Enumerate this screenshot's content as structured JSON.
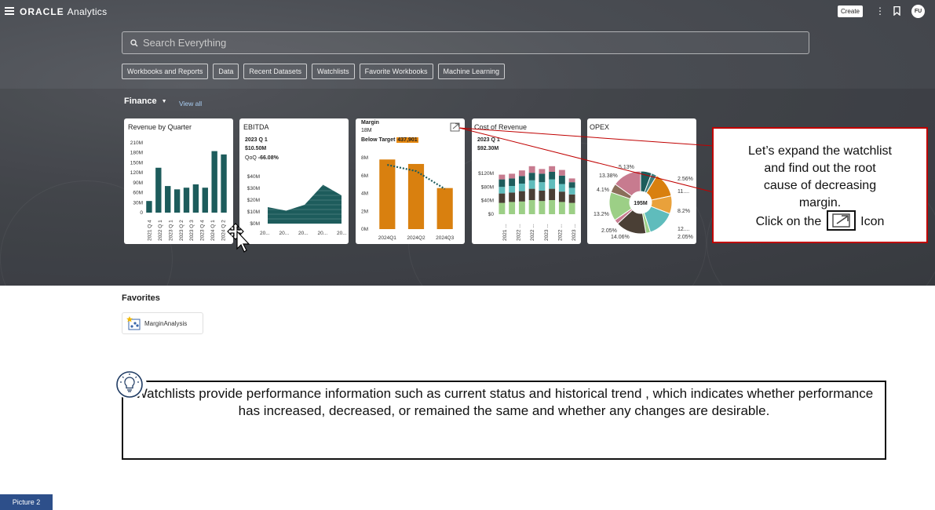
{
  "app": {
    "brand_main": "ORACLE",
    "brand_sub": "Analytics",
    "create_label": "Create",
    "avatar_initials": "FU"
  },
  "search": {
    "placeholder": "Search Everything"
  },
  "chips": [
    "Workbooks and Reports",
    "Data",
    "Recent Datasets",
    "Watchlists",
    "Favorite Workbooks",
    "Machine Learning"
  ],
  "finance": {
    "label": "Finance",
    "view_all": "View all"
  },
  "cards": {
    "revenue": {
      "title": "Revenue by Quarter",
      "chart_data": {
        "type": "bar",
        "categories": [
          "2021 Q 4",
          "2022 Q 1",
          "2023 Q 1",
          "2023 Q 2",
          "2023 Q 3",
          "2023 Q 4",
          "2024 Q 1",
          "2024 Q 2"
        ],
        "values": [
          35,
          135,
          80,
          70,
          75,
          85,
          75,
          185,
          175
        ],
        "ytick_labels": [
          "210M",
          "180M",
          "150M",
          "120M",
          "90M",
          "60M",
          "30M",
          "0"
        ],
        "ylim": [
          0,
          210
        ],
        "color": "#1d5c5c"
      }
    },
    "ebitda": {
      "title": "EBITDA",
      "kpi_period": "2023 Q 1",
      "kpi_value": "$10.50M",
      "kpi_qoq_label": "QoQ",
      "kpi_qoq_value": "-66.08%",
      "chart_data": {
        "type": "area",
        "values": [
          14,
          11,
          16,
          33,
          24
        ],
        "ytick_labels": [
          "$40M",
          "$30M",
          "$20M",
          "$10M",
          "$0M"
        ],
        "xtick_labels": [
          "20...",
          "20...",
          "20...",
          "20...",
          "20..."
        ],
        "ylim": [
          0,
          40
        ],
        "color": "#1d5c5c"
      }
    },
    "margin": {
      "title": "Margin",
      "subtitle": "18M",
      "below_label": "Below Target",
      "below_value": "437,901",
      "chart_data": {
        "type": "bar",
        "categories": [
          "2024Q1",
          "2024Q2",
          "2024Q3"
        ],
        "values": [
          7.8,
          7.3,
          4.6
        ],
        "trend": [
          7.2,
          6.5,
          4.5
        ],
        "ytick_labels": [
          "8M",
          "6M",
          "4M",
          "2M",
          "0M"
        ],
        "ylim": [
          0,
          8
        ],
        "bar_color": "#d9800f",
        "trend_color": "#1d5c5c"
      }
    },
    "cost": {
      "title": "Cost of Revenue",
      "kpi_period": "2023 Q 1",
      "kpi_value": "$92.30M",
      "chart_data": {
        "type": "bar",
        "stacked": true,
        "ytick_labels": [
          "$120M",
          "$80M",
          "$40M",
          "$0"
        ],
        "xtick_labels": [
          "2021 ...",
          "2022 ...",
          "2022 ...",
          "2023 ...",
          "2022 ...",
          "2023 ..."
        ],
        "colors": [
          "#9ccf86",
          "#4a3f35",
          "#5fbcbc",
          "#1d5c5c",
          "#c77b8f",
          "#d9800f"
        ]
      }
    },
    "opex": {
      "title": "OPEX",
      "center_label": "195M",
      "chart_data": {
        "type": "pie",
        "labels": [
          "5.13%",
          "2.56%",
          "11....",
          "8.2%",
          "12....",
          "2.05%",
          "14.06%",
          "2.05%",
          "13.2%",
          "4.1%",
          "13.38%"
        ],
        "values": [
          5.13,
          2.56,
          11.5,
          8.2,
          12.5,
          2.05,
          14.06,
          2.05,
          13.2,
          4.1,
          13.38
        ],
        "colors": [
          "#1d5c5c",
          "#3f7f7f",
          "#d9800f",
          "#e9a13b",
          "#5fbcbc",
          "#9ccf86",
          "#4a3f35",
          "#c77b8f",
          "#9ccf86",
          "#8a6f5a",
          "#c77b8f"
        ]
      }
    }
  },
  "callout": {
    "line1": "Let’s expand the watchlist",
    "line2": "and find out the root",
    "line3": "cause of decreasing",
    "line4": "margin.",
    "line5_pre": "Click on the",
    "line5_post": "Icon"
  },
  "favorites": {
    "title": "Favorites",
    "item_label": "MarginAnalysis"
  },
  "info": {
    "text": "Watchlists provide performance information such as current status and historical trend , which indicates whether performance has increased, decreased, or remained the same and whether any changes are desirable."
  },
  "picture_label": "Picture 2"
}
